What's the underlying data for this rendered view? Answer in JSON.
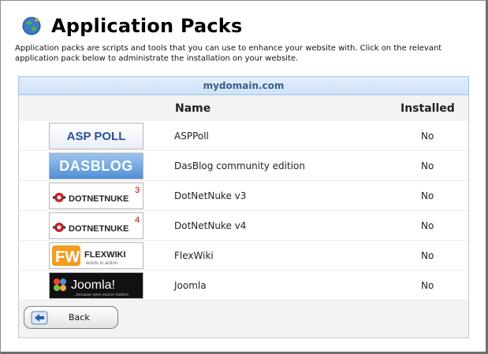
{
  "page": {
    "title": "Application Packs",
    "description": "Application packs are scripts and tools that you can use to enhance your website with. Click on the relevant application pack below to administrate the installation on your website."
  },
  "domain": "mydomain.com",
  "columns": {
    "name": "Name",
    "installed": "Installed"
  },
  "packs": [
    {
      "name": "ASPPoll",
      "installed": "No",
      "logo_text": "ASP POLL",
      "icon": "asp-poll-logo"
    },
    {
      "name": "DasBlog community edition",
      "installed": "No",
      "logo_text": "DASBLOG",
      "icon": "dasblog-logo"
    },
    {
      "name": "DotNetNuke v3",
      "installed": "No",
      "logo_text": "DOTNETNUKE",
      "logo_version": "3",
      "icon": "dotnetnuke-logo"
    },
    {
      "name": "DotNetNuke v4",
      "installed": "No",
      "logo_text": "DOTNETNUKE",
      "logo_version": "4",
      "icon": "dotnetnuke-logo"
    },
    {
      "name": "FlexWiki",
      "installed": "No",
      "logo_text": "FLEXWIKI",
      "logo_sub": "words in action",
      "icon": "flexwiki-logo"
    },
    {
      "name": "Joomla",
      "installed": "No",
      "logo_text": "Joomla!",
      "logo_sub": "...because open source matters",
      "icon": "joomla-logo"
    }
  ],
  "back_button": {
    "label": "Back"
  },
  "colors": {
    "domain_bar": "#cfe2f7",
    "domain_text": "#3a5f8a",
    "dnn_version": "#cc0000"
  }
}
